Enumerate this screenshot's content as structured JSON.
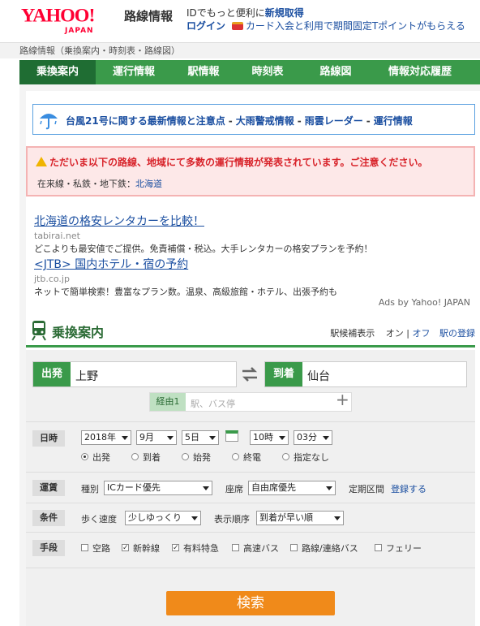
{
  "header": {
    "logo_text": "YAHOO!",
    "logo_sub": "JAPAN",
    "service_name": "路線情報",
    "id_line_prefix": "IDでもっと便利に",
    "id_line_link": "新規取得",
    "login_label": "ログイン",
    "promo_text": "カード入会と利用で期間固定Tポイントがもらえる"
  },
  "breadcrumb": "路線情報（乗換案内・時刻表・路線図）",
  "nav": [
    {
      "label": "乗換案内",
      "active": true
    },
    {
      "label": "運行情報"
    },
    {
      "label": "駅情報"
    },
    {
      "label": "時刻表"
    },
    {
      "label": "路線図"
    },
    {
      "label": "情報対応履歴"
    }
  ],
  "typhoon": {
    "link1": "台風21号に関する最新情報と注意点",
    "link2": "大雨警戒情報",
    "link3": "雨雲レーダー",
    "link4": "運行情報",
    "sep": "-"
  },
  "alert": {
    "title": "ただいま以下の路線、地域にて多数の運行情報が発表されています。ご注意ください。",
    "sub_prefix": "在来線・私鉄・地下鉄：",
    "sub_link": "北海道"
  },
  "ads": [
    {
      "title": "北海道の格安レンタカーを比較！",
      "url": "tabirai.net",
      "desc": "どこよりも最安値でご提供。免責補償・税込。大手レンタカーの格安プランを予約！"
    },
    {
      "title": "<JTB> 国内ホテル・宿の予約",
      "url": "jtb.co.jp",
      "desc": "ネットで簡単検索！豊富なプラン数。温泉、高級旅館・ホテル、出張予約も"
    }
  ],
  "ads_by": "Ads by Yahoo! JAPAN",
  "section": {
    "title": "乗換案内",
    "station_display_label": "駅候補表示",
    "on_label": "オン",
    "divider": "|",
    "off_label": "オフ",
    "station_register": "駅の登録"
  },
  "form": {
    "from_label": "出発",
    "from_value": "上野",
    "to_label": "到着",
    "to_value": "仙台",
    "via_label": "経由1",
    "via_placeholder": "駅、バス停",
    "date": {
      "label": "日時",
      "year": "2018年",
      "month": "9月",
      "day": "5日",
      "hour": "10時",
      "minute": "03分",
      "options": [
        "出発",
        "到着",
        "始発",
        "終電",
        "指定なし"
      ],
      "selected": "出発"
    },
    "fare": {
      "label": "運賃",
      "type_label": "種別",
      "type_value": "ICカード優先",
      "seat_label": "座席",
      "seat_value": "自由席優先",
      "pass_label": "定期区間",
      "pass_link": "登録する"
    },
    "conditions": {
      "label": "条件",
      "speed_label": "歩く速度",
      "speed_value": "少しゆっくり",
      "order_label": "表示順序",
      "order_value": "到着が早い順"
    },
    "means": {
      "label": "手段",
      "options": [
        {
          "label": "空路",
          "checked": false
        },
        {
          "label": "新幹線",
          "checked": true
        },
        {
          "label": "有料特急",
          "checked": true
        },
        {
          "label": "高速バス",
          "checked": false
        },
        {
          "label": "路線/連絡バス",
          "checked": false
        },
        {
          "label": "フェリー",
          "checked": false
        }
      ]
    },
    "search_label": "検索"
  },
  "colors": {
    "brand_red": "#ff0033",
    "nav_green": "#3a9a4a",
    "nav_active": "#1f6d33",
    "link_blue": "#1a4ea0",
    "alert_red": "#d8232a",
    "search_orange": "#f08a1a"
  }
}
